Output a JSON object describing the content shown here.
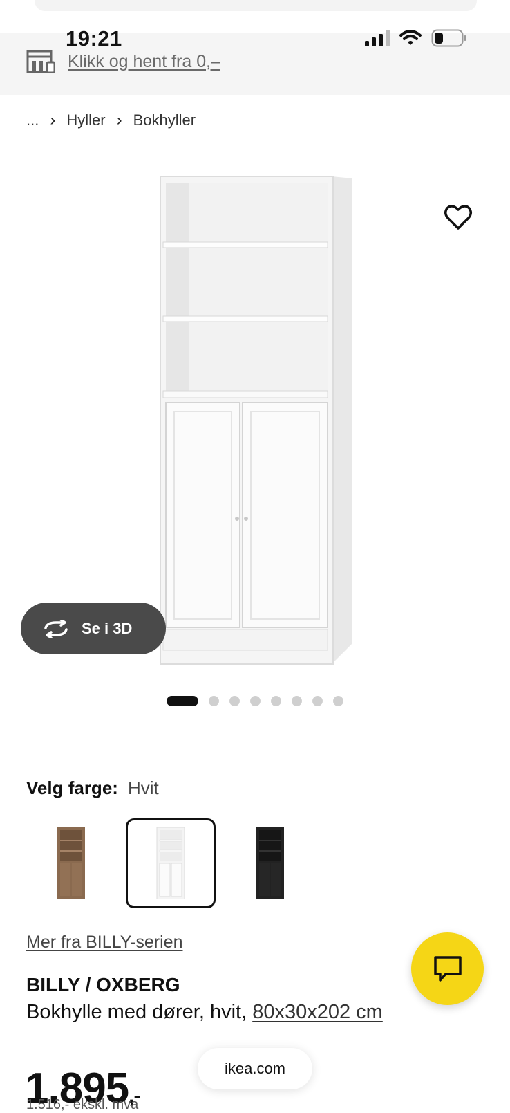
{
  "status_bar": {
    "time": "19:21"
  },
  "store": {
    "link_text": "Klikk og hent fra 0,–"
  },
  "breadcrumb": {
    "ellipsis": "...",
    "items": [
      "Hyller",
      "Bokhyller"
    ],
    "separator": "›"
  },
  "gallery": {
    "see3d_label": "Se i 3D",
    "page_count": 8,
    "current_page": 1
  },
  "color_picker": {
    "label": "Velg farge:",
    "selected_value": "Hvit",
    "options": [
      {
        "name": "brown-oak",
        "color": "#8a6a4f"
      },
      {
        "name": "white",
        "color": "#f4f4f4",
        "selected": true
      },
      {
        "name": "black",
        "color": "#222222"
      }
    ]
  },
  "series_link": "Mer fra BILLY-serien",
  "product": {
    "name": "BILLY / OXBERG",
    "description": "Bokhylle med dører, hvit, ",
    "dimensions_link": "80x30x202 cm",
    "price": "1.895",
    "price_suffix": ",-",
    "price_sub": "1.516,- ekskl. mva"
  },
  "browser": {
    "url": "ikea.com"
  },
  "colors": {
    "chat_button": "#f5d616",
    "see3d_bg": "#4a4a4a"
  }
}
